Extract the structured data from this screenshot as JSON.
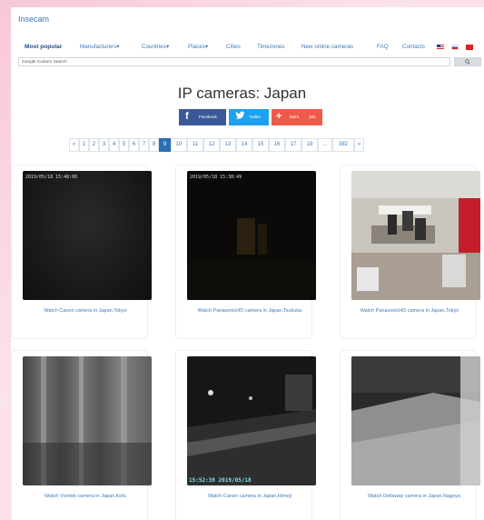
{
  "brand": "Insecam",
  "nav": {
    "items": [
      {
        "label": "Most popular",
        "active": true
      },
      {
        "label": "Manufacturers",
        "dropdown": true
      },
      {
        "label": "Countries",
        "dropdown": true
      },
      {
        "label": "Places",
        "dropdown": true
      },
      {
        "label": "Cities"
      },
      {
        "label": "Timezones"
      },
      {
        "label": "New online cameras"
      },
      {
        "label": "FAQ"
      },
      {
        "label": "Contacts"
      }
    ],
    "flags": [
      "us-flag",
      "ru-flag",
      "cn-flag"
    ],
    "caret": "▾"
  },
  "search": {
    "placeholder": "Google Custom Search",
    "button_icon": "search-icon"
  },
  "page_title": "IP cameras: Japan",
  "share": {
    "facebook": {
      "glyph": "f",
      "label": "Facebook",
      "color": "#3b5998"
    },
    "twitter": {
      "glyph": "❦",
      "label": "Twitter",
      "color": "#1da1f2"
    },
    "more": {
      "glyph": "+",
      "label": "More",
      "count": "104",
      "color": "#f05a4a"
    }
  },
  "pagination": {
    "items": [
      "«",
      "1",
      "2",
      "3",
      "4",
      "5",
      "6",
      "7",
      "8",
      "9",
      "10",
      "11",
      "12",
      "13",
      "14",
      "15",
      "16",
      "17",
      "18",
      "...",
      "382",
      "»"
    ],
    "active": "9"
  },
  "cameras": [
    {
      "caption": "Watch Canon camera in Japan,Tokyo",
      "stamp": "2019/05/18  15:48:06"
    },
    {
      "caption": "Watch PanasonicHD camera in Japan,Tsukuba",
      "stamp": "2019/05/18  15:38:49"
    },
    {
      "caption": "Watch PanasonicHD camera in Japan,Tokyo",
      "stamp": ""
    },
    {
      "caption": "Watch Vivotek camera in Japan,Kofu",
      "stamp": ""
    },
    {
      "caption": "Watch Canon camera in Japan,Himeji",
      "stamp": "15:52:38   2019/05/18"
    },
    {
      "caption": "Watch Dellaway camera in Japan,Nagoya",
      "stamp": ""
    }
  ]
}
